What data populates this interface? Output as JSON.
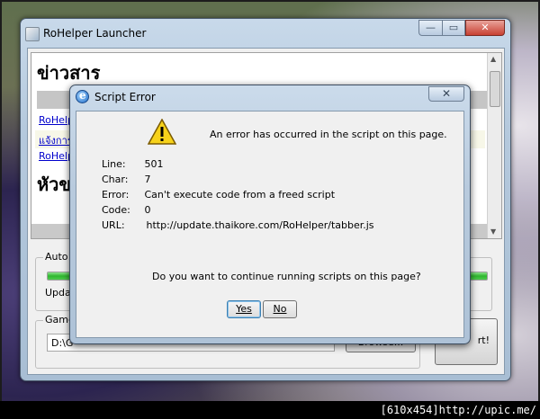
{
  "launcher": {
    "title": "RoHelper Launcher",
    "caption": {
      "minimize": "—",
      "maximize": "▭",
      "close": "✕"
    },
    "news": {
      "heading": "ข่าวสาร",
      "links": [
        "RoHelp",
        "แจ้งการ",
        "RoHelp"
      ],
      "heading2": "หัวข"
    },
    "auto_update": {
      "group_label": "Auto U",
      "status": "Upda",
      "progress": 1.0
    },
    "game_path": {
      "group_label": "Game",
      "value": "D:\\G",
      "browse_label": "Browse..."
    },
    "start_label": "rt!"
  },
  "dialog": {
    "title": "Script Error",
    "close": "✕",
    "message": "An error has occurred in the script on this page.",
    "details": [
      {
        "label": "Line:",
        "value": "501"
      },
      {
        "label": "Char:",
        "value": "7"
      },
      {
        "label": "Error:",
        "value": "Can't execute code from a freed script"
      },
      {
        "label": "Code:",
        "value": "0"
      },
      {
        "label": "URL:",
        "value": "http://update.thaikore.com/RoHelper/tabber.js"
      }
    ],
    "question": "Do you want to continue running scripts on this page?",
    "yes_label": "Yes",
    "no_label": "No"
  },
  "watermark": "[610x454]http://upic.me/"
}
